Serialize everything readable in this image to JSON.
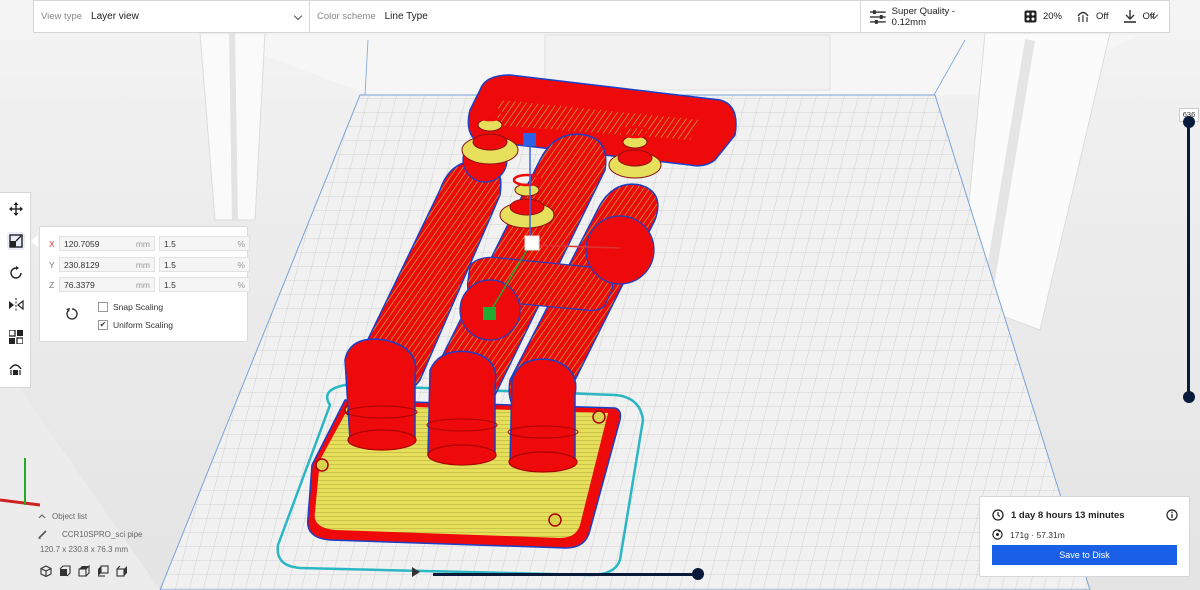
{
  "topbar": {
    "view_type_caption": "View type",
    "view_type_value": "Layer view",
    "color_scheme_caption": "Color scheme",
    "color_scheme_value": "Line Type",
    "quality": "Super Quality - 0.12mm",
    "infill": "20%",
    "support": "Off",
    "adhesion": "Off"
  },
  "tools": [
    "move-icon",
    "scale-icon",
    "rotate-icon",
    "mirror-icon",
    "per-model-settings-icon",
    "support-blocker-icon"
  ],
  "scale_panel": {
    "rows": [
      {
        "axis": "X",
        "size": "120.7059",
        "size_unit": "mm",
        "percent": "1.5",
        "percent_unit": "%"
      },
      {
        "axis": "Y",
        "size": "230.8129",
        "size_unit": "mm",
        "percent": "1.5",
        "percent_unit": "%"
      },
      {
        "axis": "Z",
        "size": "76.3379",
        "size_unit": "mm",
        "percent": "1.5",
        "percent_unit": "%"
      }
    ],
    "snap_scaling": "Snap Scaling",
    "snap_checked": false,
    "uniform_scaling": "Uniform Scaling",
    "uniform_checked": true
  },
  "object_list": {
    "title": "Object list",
    "object_name": "CCR10SPRO_sci pipe",
    "dimensions": "120.7 x 230.8 x 76.3 mm"
  },
  "layer_slider": {
    "value": "636",
    "fraction": 1.0
  },
  "playback": {
    "fraction": 1.0
  },
  "print_info": {
    "time": "1 day 8 hours 13 minutes",
    "material": "171g · 57.31m",
    "save_label": "Save to Disk"
  },
  "colors": {
    "accent": "#1960e6",
    "slider": "#0a1a3a",
    "wall_red": "#ff0000",
    "infill_yellow": "#e5e05a",
    "skirt_cyan": "#2bb6c4"
  }
}
